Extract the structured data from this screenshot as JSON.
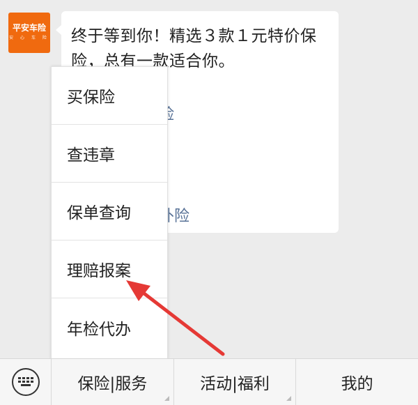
{
  "chat": {
    "avatar": {
      "brand": "平安车险",
      "tagline": "安 心 车 险",
      "color": "#f06a0f"
    },
    "message": {
      "text": "终于等到你！精选３款１元特价保险，总有一款适合你。",
      "partial_links": [
        "险",
        "外险"
      ],
      "link_color": "#577196"
    }
  },
  "popup_menu": {
    "items": [
      {
        "label": "买保险"
      },
      {
        "label": "查违章"
      },
      {
        "label": "保单查询"
      },
      {
        "label": "理赔报案"
      },
      {
        "label": "年检代办"
      }
    ]
  },
  "annotation": {
    "arrow_color": "#e53935",
    "points_to": "理赔报案"
  },
  "bottom_bar": {
    "keyboard_icon": "keyboard-icon",
    "tabs": [
      {
        "label": "保险|服务"
      },
      {
        "label": "活动|福利"
      },
      {
        "label": "我的"
      }
    ]
  }
}
